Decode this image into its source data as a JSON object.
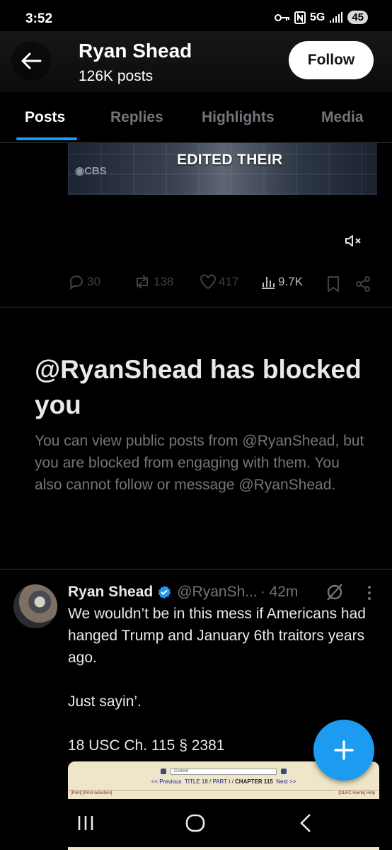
{
  "status_bar": {
    "time": "3:52",
    "network": "5G",
    "battery": "45"
  },
  "header": {
    "name": "Ryan Shead",
    "posts_count": "126K posts",
    "follow_label": "Follow"
  },
  "tabs": [
    {
      "label": "Posts",
      "active": true
    },
    {
      "label": "Replies",
      "active": false
    },
    {
      "label": "Highlights",
      "active": false
    },
    {
      "label": "Media",
      "active": false
    }
  ],
  "video": {
    "caption": "EDITED THEIR",
    "logo": "CBS"
  },
  "actions": {
    "replies": "30",
    "reposts": "138",
    "likes": "417",
    "views": "9.7K"
  },
  "blocked": {
    "title": "@RyanShead has blocked you",
    "description": "You can view public posts from @RyanShead, but you are blocked from engaging with them. You also cannot follow or message @RyanShead."
  },
  "tweet": {
    "name": "Ryan Shead",
    "handle": "@RyanSh...",
    "time": "· 42m",
    "text": "We wouldn’t be in this mess if Americans had hanged Trump and January 6th traitors years ago.\n\nJust sayin’.\n\n18 USC Ch. 115 § 2381"
  },
  "embed": {
    "select_text": "Current",
    "nav": {
      "prev": "<< Previous",
      "title": "TITLE 18",
      "part": "PART I",
      "chapter": "CHAPTER 115",
      "next": "Next >>"
    },
    "left_links": "[Print]   [Print selection]",
    "right_links": "[OLRC Home]  Help"
  },
  "colors": {
    "accent": "#1d9bf0",
    "background": "#000000",
    "muted": "#71767b",
    "text": "#e7e9ea"
  },
  "icons": [
    "arrow-left-icon",
    "mute-icon",
    "reply-icon",
    "repost-icon",
    "like-icon",
    "views-icon",
    "bookmark-icon",
    "share-icon",
    "verified-icon",
    "grok-icon",
    "more-icon",
    "plus-icon",
    "recents-icon",
    "home-icon",
    "back-icon"
  ]
}
